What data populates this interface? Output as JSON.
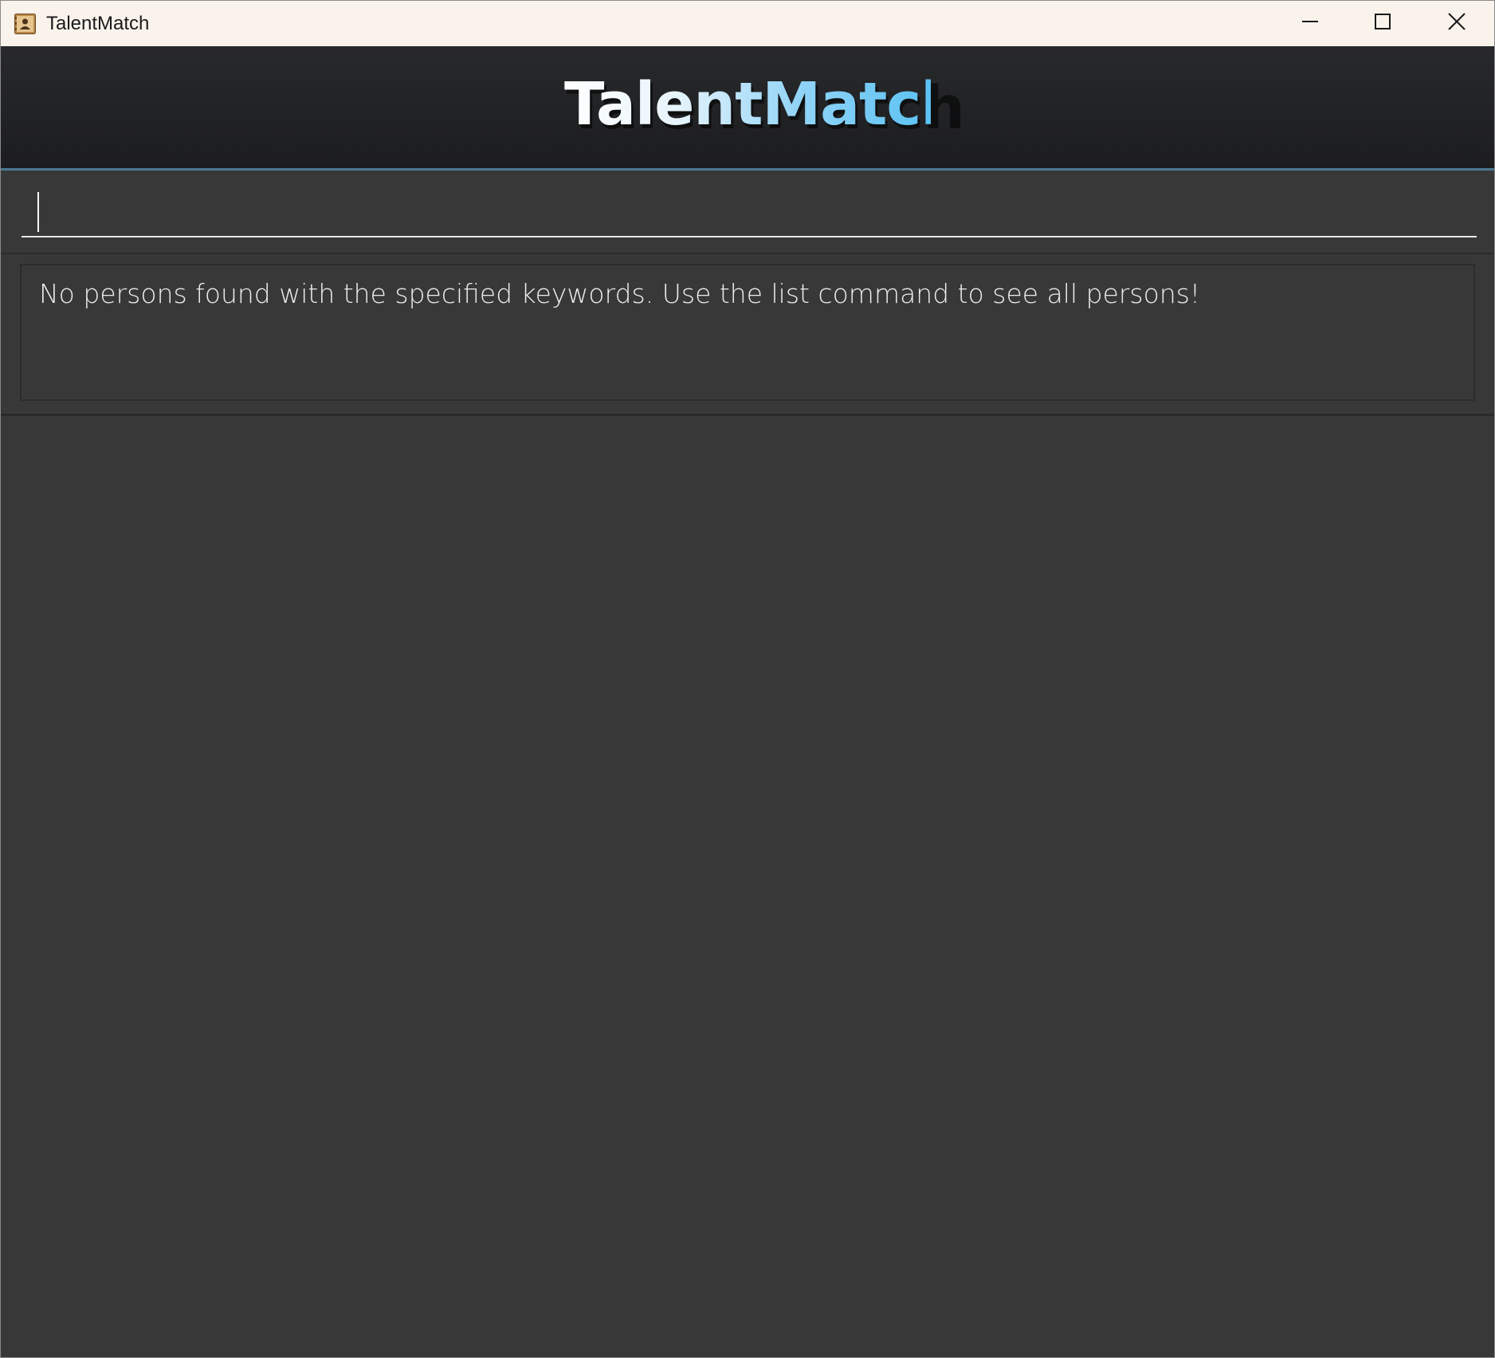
{
  "window": {
    "title": "TalentMatch",
    "controls": {
      "minimize": "minimize-icon",
      "maximize": "maximize-icon",
      "close": "close-icon"
    }
  },
  "header": {
    "title": "TalentMatch"
  },
  "command": {
    "value": "",
    "placeholder": ""
  },
  "result": {
    "message": "No persons found with the specified keywords. Use the list command to see all persons!"
  },
  "person_list": {
    "items": []
  },
  "colors": {
    "titlebar_bg": "#f9f3ec",
    "app_bg": "#383838",
    "header_bg": "#1f2022",
    "header_accent": "#4c7a91",
    "title_gradient_start": "#ffffff",
    "title_gradient_end": "#5cc2f2"
  }
}
